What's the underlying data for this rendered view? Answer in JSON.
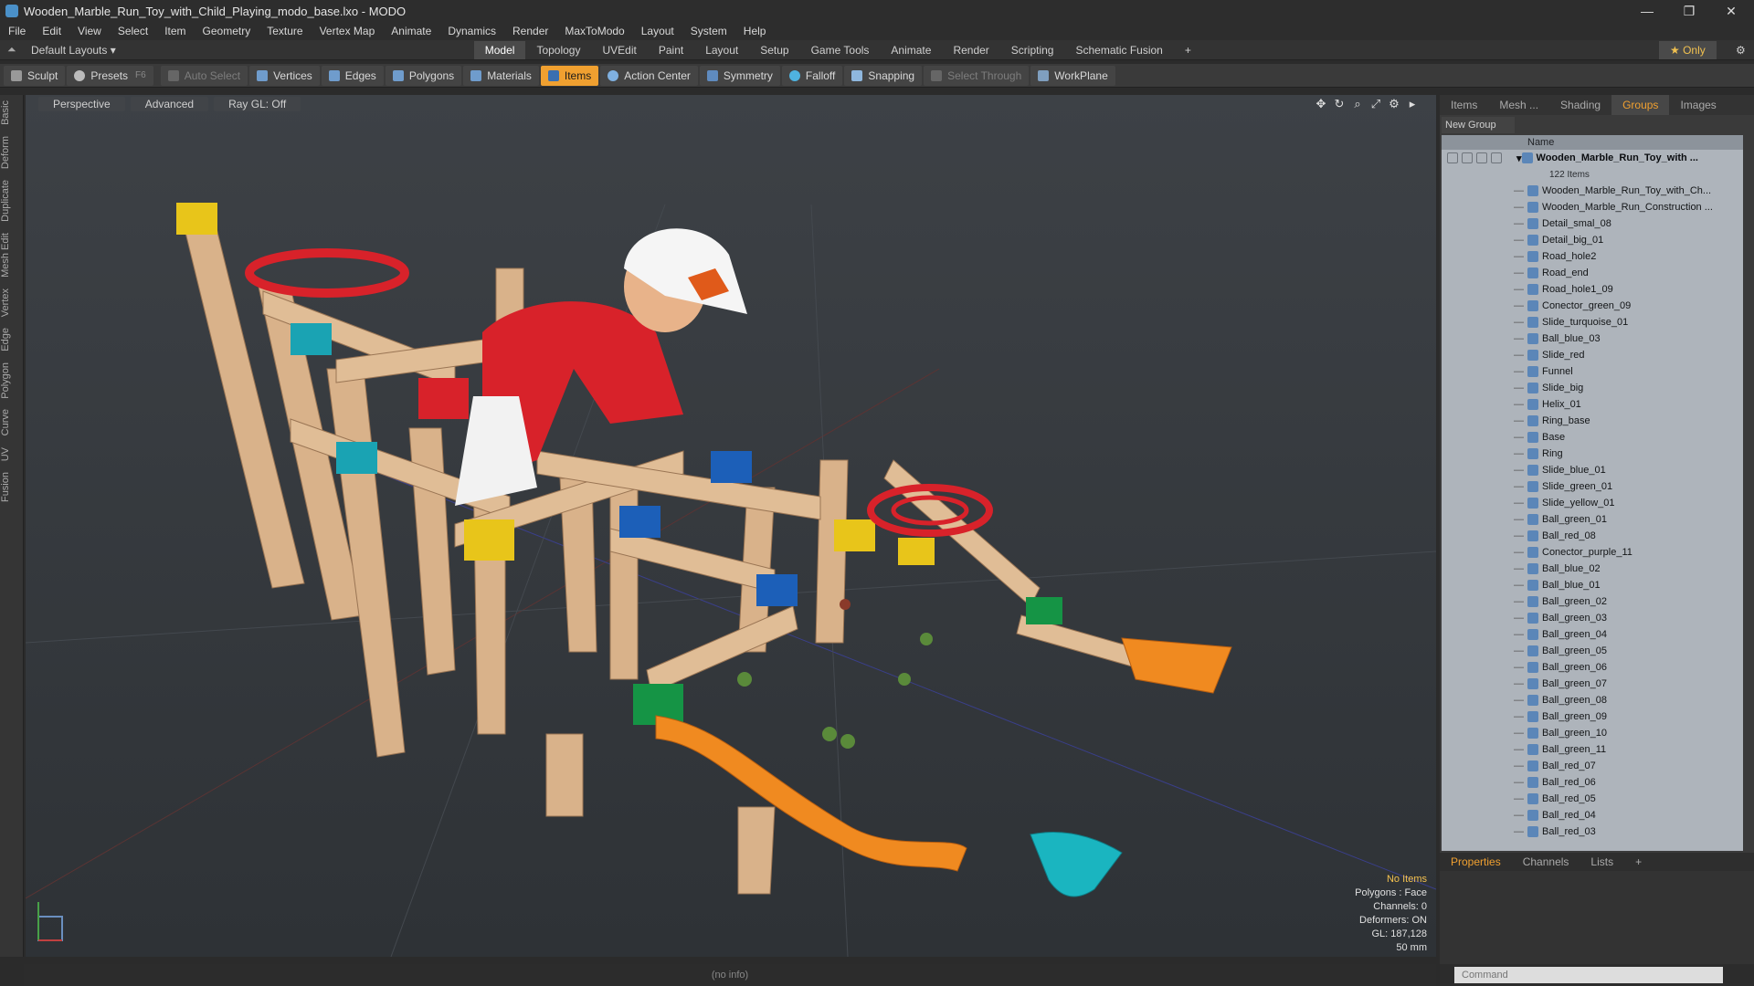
{
  "window": {
    "title": "Wooden_Marble_Run_Toy_with_Child_Playing_modo_base.lxo - MODO"
  },
  "menu": [
    "File",
    "Edit",
    "View",
    "Select",
    "Item",
    "Geometry",
    "Texture",
    "Vertex Map",
    "Animate",
    "Dynamics",
    "Render",
    "MaxToModo",
    "Layout",
    "System",
    "Help"
  ],
  "layout_bar": {
    "default_layouts": "Default Layouts",
    "tabs": [
      "Model",
      "Topology",
      "UVEdit",
      "Paint",
      "Layout",
      "Setup",
      "Game Tools",
      "Animate",
      "Render",
      "Scripting",
      "Schematic Fusion"
    ],
    "active_tab": "Model",
    "only_label": "Only"
  },
  "toolbar": {
    "sculpt": "Sculpt",
    "presets": "Presets",
    "presets_hotkey": "F6",
    "auto_select": "Auto Select",
    "vertices": "Vertices",
    "edges": "Edges",
    "polygons": "Polygons",
    "materials": "Materials",
    "items": "Items",
    "action_center": "Action Center",
    "symmetry": "Symmetry",
    "falloff": "Falloff",
    "snapping": "Snapping",
    "select_through": "Select Through",
    "workplane": "WorkPlane"
  },
  "left_tabs": [
    "Basic",
    "Deform",
    "Duplicate",
    "Mesh Edit",
    "Vertex",
    "Edge",
    "Polygon",
    "Curve",
    "UV",
    "Fusion"
  ],
  "viewport": {
    "header": [
      "Perspective",
      "Advanced",
      "Ray GL: Off"
    ],
    "hud": {
      "no_items": "No Items",
      "polygons": "Polygons : Face",
      "channels": "Channels: 0",
      "deformers": "Deformers: ON",
      "gl": "GL: 187,128",
      "units": "50 mm"
    },
    "status": "(no info)"
  },
  "right_panel": {
    "tabs": [
      "Items",
      "Mesh ...",
      "Shading",
      "Groups",
      "Images"
    ],
    "active_tab": "Groups",
    "new_group": "New Group",
    "column_name": "Name",
    "group_name": "Wooden_Marble_Run_Toy_with ...",
    "group_count": "122 Items",
    "items": [
      "Wooden_Marble_Run_Toy_with_Ch...",
      "Wooden_Marble_Run_Construction ...",
      "Detail_smal_08",
      "Detail_big_01",
      "Road_hole2",
      "Road_end",
      "Road_hole1_09",
      "Conector_green_09",
      "Slide_turquoise_01",
      "Ball_blue_03",
      "Slide_red",
      "Funnel",
      "Slide_big",
      "Helix_01",
      "Ring_base",
      "Base",
      "Ring",
      "Slide_blue_01",
      "Slide_green_01",
      "Slide_yellow_01",
      "Ball_green_01",
      "Ball_red_08",
      "Conector_purple_11",
      "Ball_blue_02",
      "Ball_blue_01",
      "Ball_green_02",
      "Ball_green_03",
      "Ball_green_04",
      "Ball_green_05",
      "Ball_green_06",
      "Ball_green_07",
      "Ball_green_08",
      "Ball_green_09",
      "Ball_green_10",
      "Ball_green_11",
      "Ball_red_07",
      "Ball_red_06",
      "Ball_red_05",
      "Ball_red_04",
      "Ball_red_03"
    ]
  },
  "bottom_panel": {
    "tabs": [
      "Properties",
      "Channels",
      "Lists"
    ],
    "active_tab": "Properties"
  },
  "command": {
    "placeholder": "Command"
  }
}
